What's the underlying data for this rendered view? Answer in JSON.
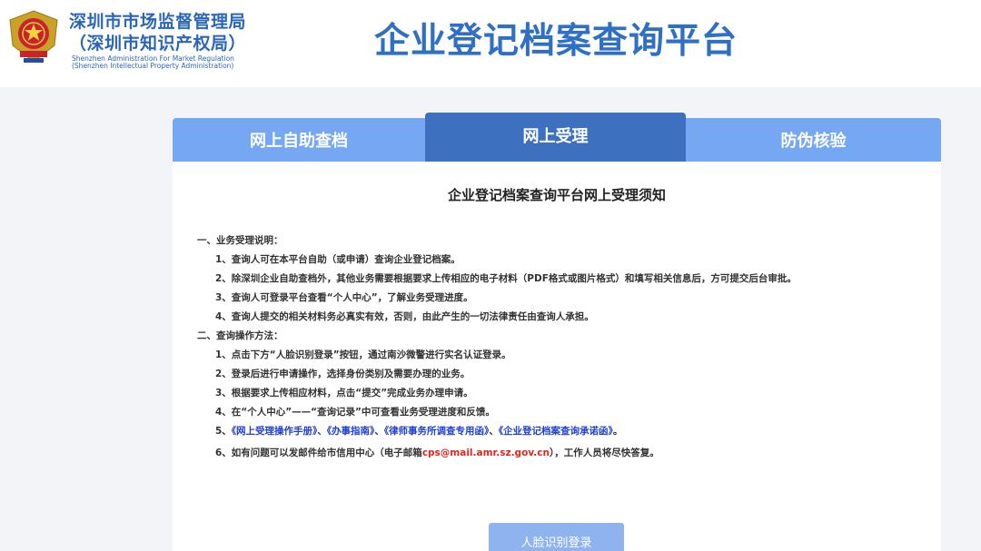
{
  "header": {
    "org_cn_line1": "深圳市市场监督管理局",
    "org_cn_line2": "（深圳市知识产权局）",
    "org_en_line1": "Shenzhen Administration For Market Regulation",
    "org_en_line2": "(Shenzhen Intellectual Property Administration)",
    "platform_title": "企业登记档案查询平台"
  },
  "tabs": [
    {
      "label": "网上自助查档",
      "active": false
    },
    {
      "label": "网上受理",
      "active": true
    },
    {
      "label": "防伪核验",
      "active": false
    }
  ],
  "notice": {
    "title": "企业登记档案查询平台网上受理须知",
    "section1": {
      "heading": "一、业务受理说明：",
      "items": [
        "1、查询人可在本平台自助（或申请）查询企业登记档案。",
        "2、除深圳企业自助查档外，其他业务需要根据要求上传相应的电子材料（PDF格式或图片格式）和填写相关信息后，方可提交后台审批。",
        "3、查询人可登录平台查看“个人中心”，了解业务受理进度。",
        "4、查询人提交的相关材料务必真实有效，否则，由此产生的一切法律责任由查询人承担。"
      ]
    },
    "section2": {
      "heading": "二、查询操作方法：",
      "items": [
        "1、点击下方“人脸识别登录”按钮，通过南沙微警进行实名认证登录。",
        "2、登录后进行申请操作，选择身份类别及需要办理的业务。",
        "3、根据要求上传相应材料，点击“提交”完成业务办理申请。",
        "4、在“个人中心”——“查询记录”中可查看业务受理进度和反馈。"
      ],
      "item5": {
        "prefix": "5、",
        "link1": "《网上受理操作手册》",
        "sep1": "、",
        "link2": "《办事指南》",
        "sep2": "、",
        "link3": "《律师事务所调查专用函》",
        "sep3": "、",
        "link4": "《企业登记档案查询承诺函》",
        "suffix": "。"
      },
      "item6": {
        "prefix": "6、如有问题可以发邮件给市信用中心（电子邮箱",
        "email": "cps@mail.amr.sz.gov.cn",
        "suffix": "），工作人员将尽快答复。"
      }
    }
  },
  "login_button_label": "人脸识别登录",
  "colors": {
    "brand_blue": "#2f6fc4",
    "tab_inactive": "#75a7f2",
    "tab_active": "#3e70c0",
    "link": "#1f3fcf",
    "email": "#e0241f",
    "button": "#8fb3ee"
  }
}
